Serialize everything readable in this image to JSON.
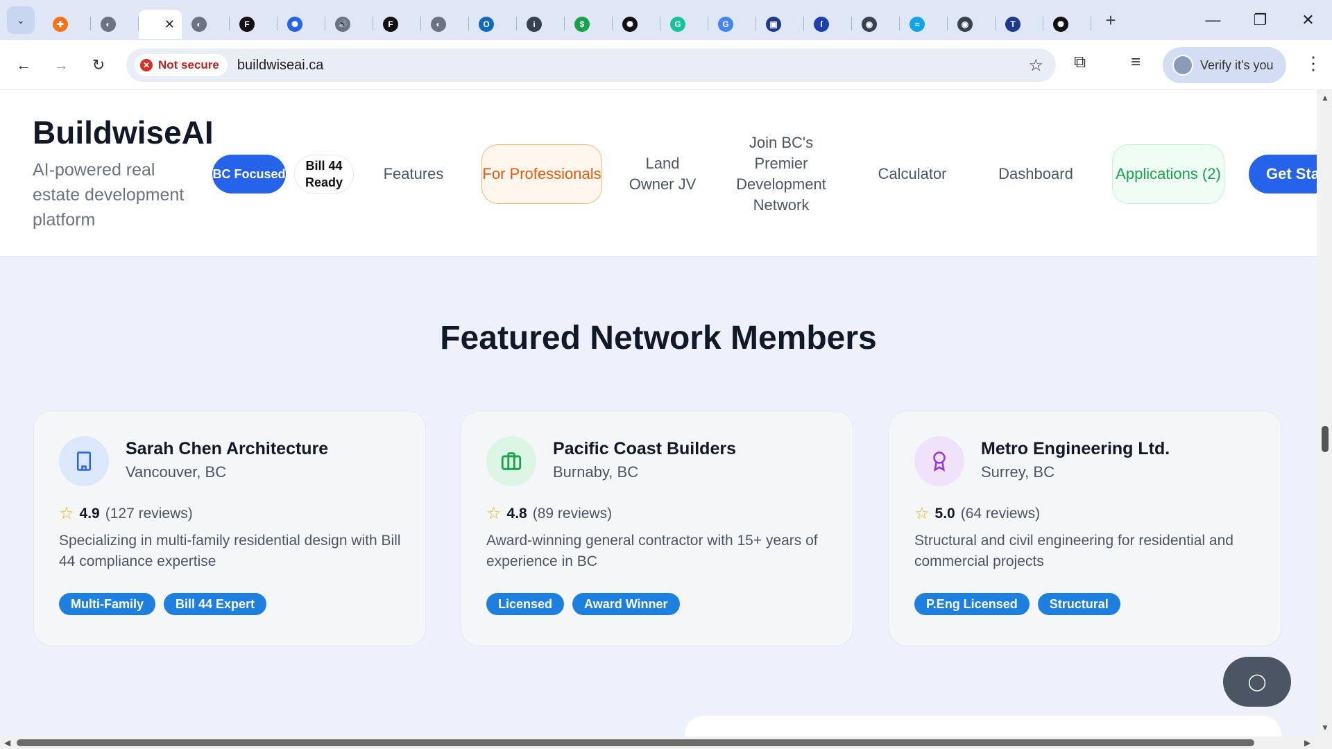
{
  "browser": {
    "tabs": [
      {
        "icon": "puzzle-orange-icon",
        "color": "#f97316",
        "glyph": "✚"
      },
      {
        "icon": "globe-icon",
        "color": "#6b7280",
        "glyph": "◐"
      },
      {
        "icon": "active-tab",
        "color": "#ffffff",
        "glyph": "",
        "active": true
      },
      {
        "icon": "globe-icon",
        "color": "#6b7280",
        "glyph": "◐"
      },
      {
        "icon": "framer-icon",
        "color": "#111111",
        "glyph": "F"
      },
      {
        "icon": "openai-icon",
        "color": "#2563eb",
        "glyph": "✺"
      },
      {
        "icon": "audio-icon",
        "color": "#6b7280",
        "glyph": "🔊"
      },
      {
        "icon": "framer-icon",
        "color": "#111111",
        "glyph": "F"
      },
      {
        "icon": "globe-icon",
        "color": "#6b7280",
        "glyph": "◐"
      },
      {
        "icon": "outlook-icon",
        "color": "#0f6cbd",
        "glyph": "O"
      },
      {
        "icon": "info-icon",
        "color": "#374151",
        "glyph": "i"
      },
      {
        "icon": "dollar-icon",
        "color": "#16a34a",
        "glyph": "$"
      },
      {
        "icon": "openai-icon",
        "color": "#111111",
        "glyph": "✺"
      },
      {
        "icon": "grammarly-icon",
        "color": "#15c39a",
        "glyph": "G"
      },
      {
        "icon": "google-icon",
        "color": "#4285f4",
        "glyph": "G"
      },
      {
        "icon": "app-icon",
        "color": "#1e3a8a",
        "glyph": "▣"
      },
      {
        "icon": "notion-icon",
        "color": "#1e40af",
        "glyph": "ſ"
      },
      {
        "icon": "chrome-icon",
        "color": "#374151",
        "glyph": "◉"
      },
      {
        "icon": "chart-icon",
        "color": "#0ea5e9",
        "glyph": "≈"
      },
      {
        "icon": "chrome-icon",
        "color": "#374151",
        "glyph": "◉"
      },
      {
        "icon": "tix-icon",
        "color": "#1e3a8a",
        "glyph": "T"
      },
      {
        "icon": "openai-icon",
        "color": "#111111",
        "glyph": "✺"
      }
    ],
    "new_tab_label": "+",
    "url": "buildwiseai.ca",
    "security_label": "Not secure",
    "profile_label": "Verify it's you"
  },
  "header": {
    "brand": "BuildwiseAI",
    "tagline": "AI-powered real estate development platform",
    "badges": {
      "bc": "BC Focused",
      "bill": "Bill 44 Ready"
    },
    "nav": {
      "features": "Features",
      "professionals": "For Professionals",
      "land_owner": "Land Owner JV",
      "join": "Join BC's Premier Development Network",
      "calculator": "Calculator",
      "dashboard": "Dashboard",
      "applications": "Applications (2)"
    },
    "cta": "Get Started"
  },
  "section": {
    "title": "Featured Network Members"
  },
  "members": [
    {
      "name": "Sarah Chen Architecture",
      "location": "Vancouver, BC",
      "rating": "4.9",
      "reviews": "(127 reviews)",
      "description": "Specializing in multi-family residential design with Bill 44 compliance expertise",
      "tags": [
        "Multi-Family",
        "Bill 44 Expert"
      ],
      "icon": "building-icon",
      "icon_color": "#2563eb",
      "icon_bg": "#dbe7fb"
    },
    {
      "name": "Pacific Coast Builders",
      "location": "Burnaby, BC",
      "rating": "4.8",
      "reviews": "(89 reviews)",
      "description": "Award-winning general contractor with 15+ years of experience in BC",
      "tags": [
        "Licensed",
        "Award Winner"
      ],
      "icon": "briefcase-icon",
      "icon_color": "#16a34a",
      "icon_bg": "#dcf5e5"
    },
    {
      "name": "Metro Engineering Ltd.",
      "location": "Surrey, BC",
      "rating": "5.0",
      "reviews": "(64 reviews)",
      "description": "Structural and civil engineering for residential and commercial projects",
      "tags": [
        "P.Eng Licensed",
        "Structural"
      ],
      "icon": "award-icon",
      "icon_color": "#9333ea",
      "icon_bg": "#efe3fb"
    }
  ]
}
